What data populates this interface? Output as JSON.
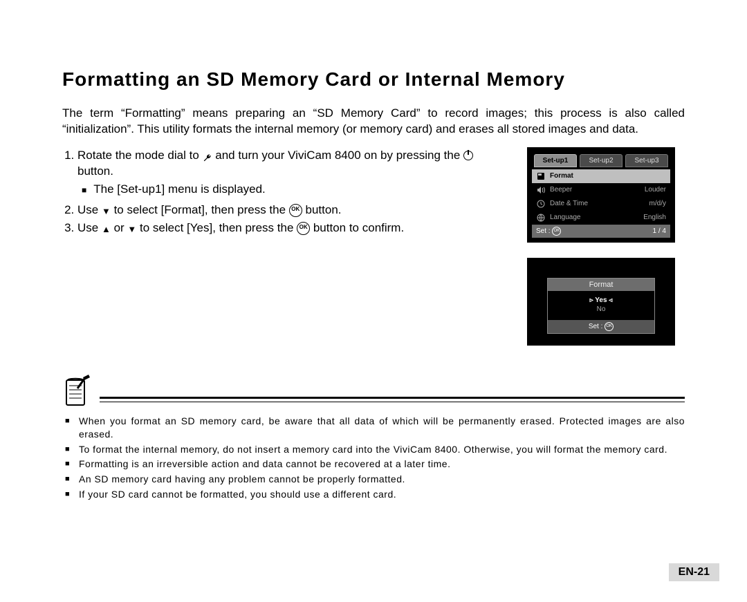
{
  "title": "Formatting an SD Memory Card or Internal Memory",
  "intro": "The term “Formatting” means preparing an “SD Memory Card” to record images; this process is also called “initialization”. This utility formats the internal memory (or memory card) and erases all stored images and data.",
  "steps": {
    "s1a": "Rotate the mode dial to ",
    "s1b": " and turn your ViviCam 8400 on by pressing the ",
    "s1c": " button.",
    "s1_sub": "The [Set-up1] menu is displayed.",
    "s2a": "Use ",
    "s2b": " to select [Format], then press the ",
    "s2c": " button.",
    "s3a": "Use ",
    "s3b": " or ",
    "s3c": " to select [Yes], then press the ",
    "s3d": " button to confirm."
  },
  "screen1": {
    "tabs": [
      "Set-up1",
      "Set-up2",
      "Set-up3"
    ],
    "items": [
      {
        "label": "Format",
        "value": ""
      },
      {
        "label": "Beeper",
        "value": "Louder"
      },
      {
        "label": "Date & Time",
        "value": "m/d/y"
      },
      {
        "label": "Language",
        "value": "English"
      }
    ],
    "bottom_left": "Set :",
    "bottom_right": "1 / 4"
  },
  "screen2": {
    "title": "Format",
    "opt_yes": "Yes",
    "opt_no": "No",
    "foot": "Set :"
  },
  "notes": [
    "When you format an SD memory card, be aware that all data of which will be permanently erased. Protected images are also erased.",
    "To format the internal memory, do not insert a memory card into the ViviCam 8400. Otherwise, you will format the memory card.",
    "Formatting is an irreversible action and data cannot be recovered at a later time.",
    "An SD memory card having any problem cannot be properly formatted.",
    "If your SD card cannot be formatted, you should use a different card."
  ],
  "page_number": "EN-21",
  "ok_label": "OK"
}
